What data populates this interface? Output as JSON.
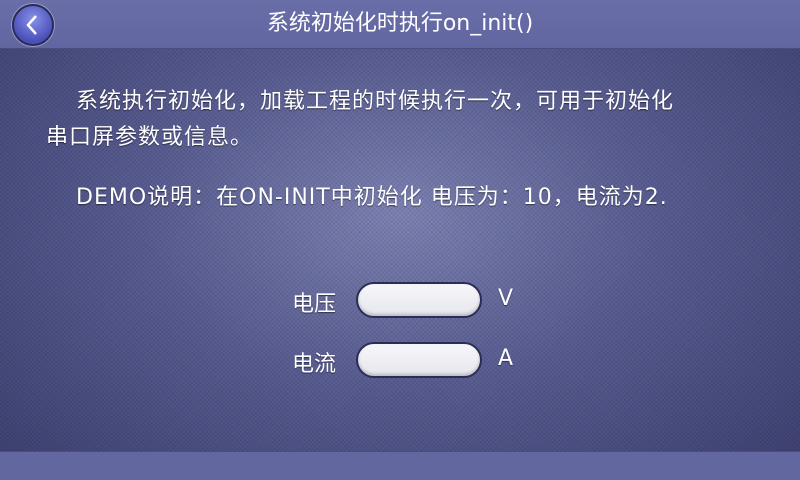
{
  "header": {
    "title": "系统初始化时执行on_init()",
    "back_icon": "chevron-left-icon"
  },
  "description": {
    "line1": "系统执行初始化，加载工程的时候执行一次，可用于初始化",
    "line2": "串口屏参数或信息。",
    "line3": "DEMO说明：在ON-INIT中初始化 电压为：10，电流为2."
  },
  "form": {
    "voltage": {
      "label": "电压",
      "value": "",
      "unit": "V"
    },
    "current": {
      "label": "电流",
      "value": "",
      "unit": "A"
    }
  }
}
